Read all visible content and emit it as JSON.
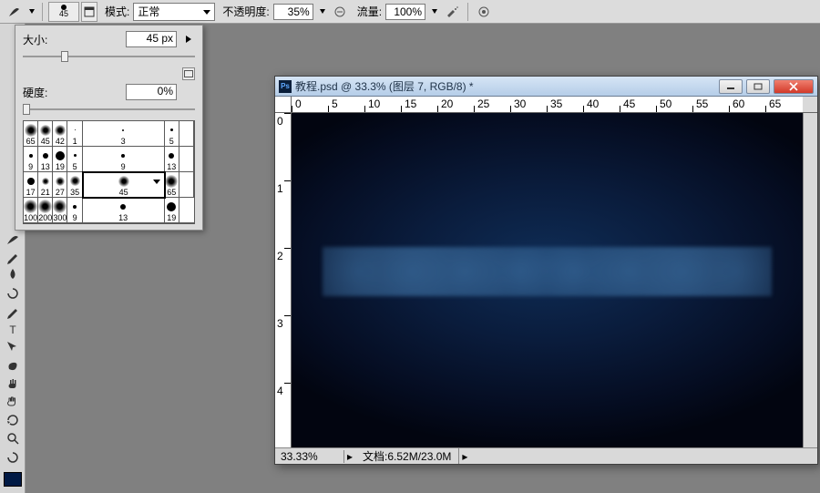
{
  "options_bar": {
    "brush_preview_size": "45",
    "mode_label": "模式:",
    "mode_value": "正常",
    "opacity_label": "不透明度:",
    "opacity_value": "35%",
    "flow_label": "流量:",
    "flow_value": "100%"
  },
  "brush_panel": {
    "size_label": "大小:",
    "size_value": "45 px",
    "hardness_label": "硬度:",
    "hardness_value": "0%",
    "size_slider_pos": 22,
    "hardness_slider_pos": 0,
    "presets": [
      {
        "n": "65",
        "t": "soft",
        "s": 14
      },
      {
        "n": "45",
        "t": "soft",
        "s": 12
      },
      {
        "n": "42",
        "t": "soft",
        "s": 12
      },
      {
        "n": "1",
        "t": "hard",
        "s": 1
      },
      {
        "n": "3",
        "t": "hard",
        "s": 2
      },
      {
        "n": "5",
        "t": "hard",
        "s": 3
      },
      {
        "n": "",
        "t": "none",
        "s": 0
      },
      {
        "n": "9",
        "t": "hard",
        "s": 4
      },
      {
        "n": "13",
        "t": "hard",
        "s": 6
      },
      {
        "n": "19",
        "t": "hard",
        "s": 10
      },
      {
        "n": "5",
        "t": "hard",
        "s": 3
      },
      {
        "n": "9",
        "t": "hard",
        "s": 4
      },
      {
        "n": "13",
        "t": "hard",
        "s": 6
      },
      {
        "n": "",
        "t": "none",
        "s": 0
      },
      {
        "n": "17",
        "t": "hard",
        "s": 8
      },
      {
        "n": "21",
        "t": "soft",
        "s": 8
      },
      {
        "n": "27",
        "t": "soft",
        "s": 10
      },
      {
        "n": "35",
        "t": "soft",
        "s": 11
      },
      {
        "n": "45",
        "t": "soft",
        "s": 12,
        "sel": true
      },
      {
        "n": "65",
        "t": "soft",
        "s": 14
      },
      {
        "n": "",
        "t": "none",
        "s": 0
      },
      {
        "n": "100",
        "t": "soft",
        "s": 15
      },
      {
        "n": "200",
        "t": "soft",
        "s": 15
      },
      {
        "n": "300",
        "t": "soft",
        "s": 15
      },
      {
        "n": "9",
        "t": "hard",
        "s": 4
      },
      {
        "n": "13",
        "t": "hard",
        "s": 6
      },
      {
        "n": "19",
        "t": "hard",
        "s": 10
      },
      {
        "n": "",
        "t": "none",
        "s": 0
      }
    ]
  },
  "tools": [
    {
      "name": "brush-tool",
      "g": "brush"
    },
    {
      "name": "pencil-tool",
      "g": "pencil"
    },
    {
      "name": "bucket-tool",
      "g": "drop"
    },
    {
      "name": "mixer-tool",
      "g": "swirl"
    },
    {
      "name": "eraser-tool",
      "g": "pencil"
    },
    {
      "name": "type-tool",
      "g": "T"
    },
    {
      "name": "path-tool",
      "g": "arrow"
    },
    {
      "name": "shape-tool",
      "g": "blob"
    },
    {
      "name": "hand-tool",
      "g": "hand"
    },
    {
      "name": "grab-tool",
      "g": "hand2"
    },
    {
      "name": "rotate-tool",
      "g": "rot"
    },
    {
      "name": "zoom-tool",
      "g": "mag"
    },
    {
      "name": "patch-tool",
      "g": "swirl"
    }
  ],
  "doc_window": {
    "title": "教程.psd @ 33.3% (图层 7, RGB/8) *",
    "zoom": "33.33%",
    "docinfo_label": "文档:",
    "docinfo_value": "6.52M/23.0M",
    "hruler_ticks": [
      "0",
      "5",
      "10",
      "15",
      "20",
      "25",
      "30",
      "35",
      "40",
      "45",
      "50",
      "55",
      "60",
      "65"
    ],
    "vruler_ticks": [
      "0",
      "1",
      "2",
      "3",
      "4"
    ]
  }
}
